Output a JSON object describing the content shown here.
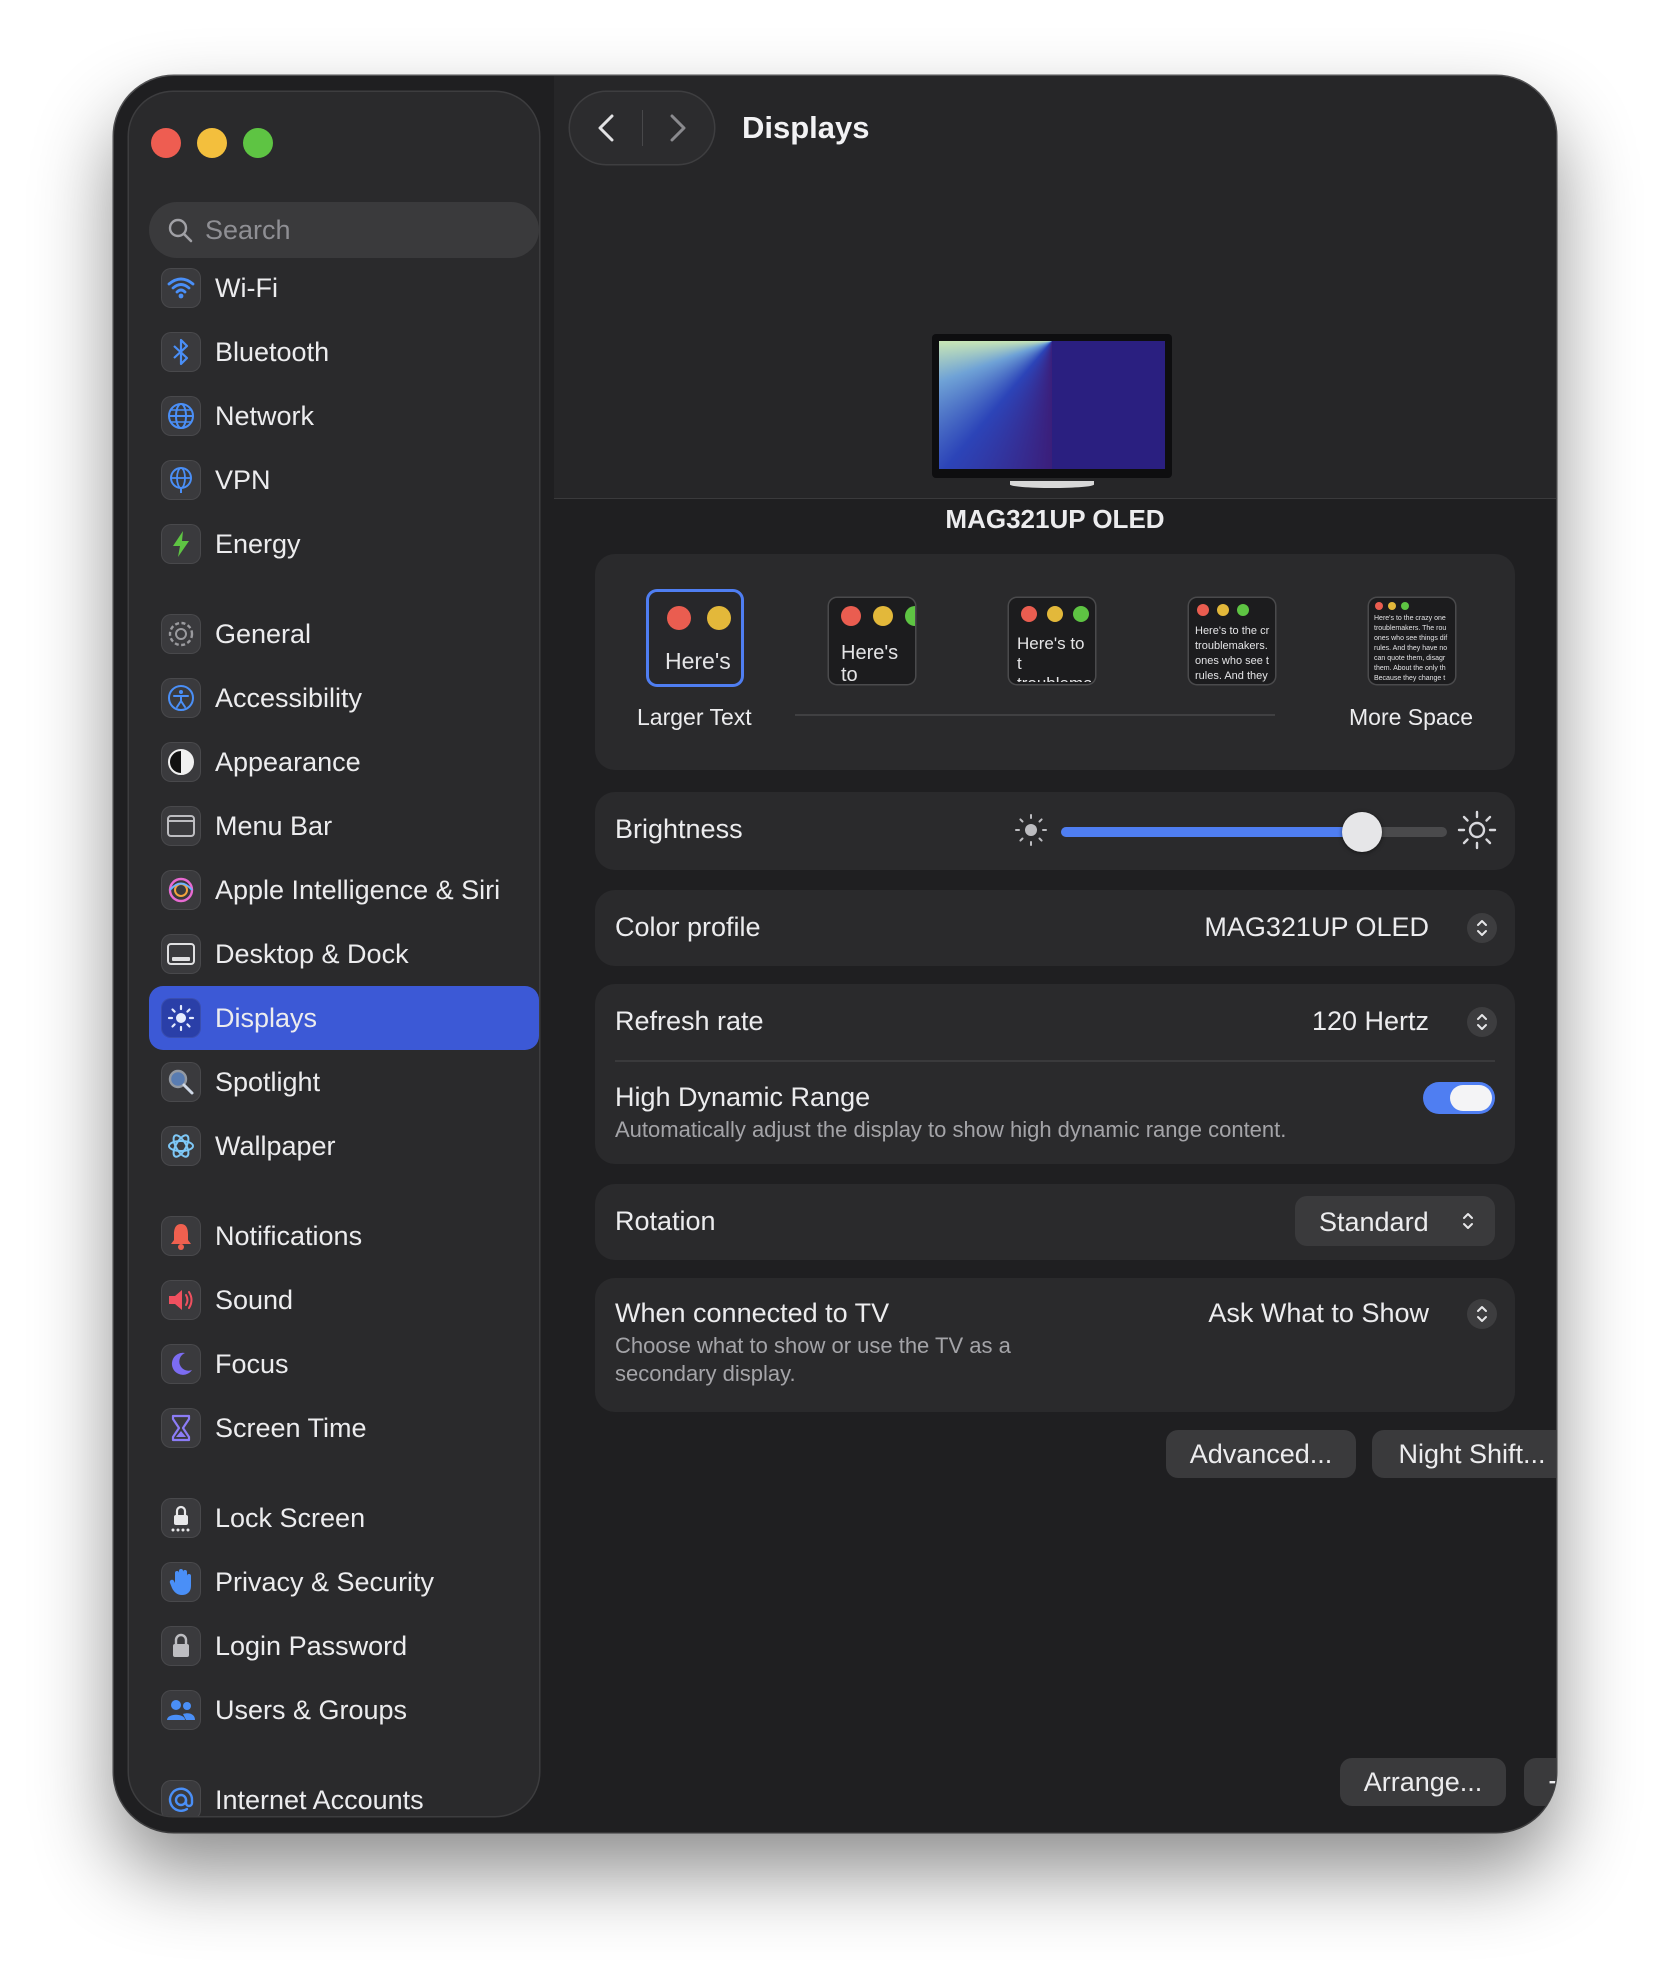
{
  "window": {
    "title": "Displays",
    "traffic_lights": [
      "close-button",
      "minimize-button",
      "zoom-button"
    ]
  },
  "sidebar": {
    "search_placeholder": "Search",
    "groups": [
      [
        {
          "label": "Wi-Fi",
          "icon": "wifi-icon"
        },
        {
          "label": "Bluetooth",
          "icon": "bluetooth-icon"
        },
        {
          "label": "Network",
          "icon": "globe-icon"
        },
        {
          "label": "VPN",
          "icon": "vpn-globe-icon"
        },
        {
          "label": "Energy",
          "icon": "lightning-icon"
        }
      ],
      [
        {
          "label": "General",
          "icon": "gear-icon"
        },
        {
          "label": "Accessibility",
          "icon": "accessibility-icon"
        },
        {
          "label": "Appearance",
          "icon": "appearance-icon"
        },
        {
          "label": "Menu Bar",
          "icon": "menu-bar-icon"
        },
        {
          "label": "Apple Intelligence & Siri",
          "icon": "siri-icon"
        },
        {
          "label": "Desktop & Dock",
          "icon": "dock-icon"
        },
        {
          "label": "Displays",
          "icon": "sun-icon",
          "active": true
        },
        {
          "label": "Spotlight",
          "icon": "spotlight-icon"
        },
        {
          "label": "Wallpaper",
          "icon": "wallpaper-icon"
        }
      ],
      [
        {
          "label": "Notifications",
          "icon": "bell-icon"
        },
        {
          "label": "Sound",
          "icon": "speaker-icon"
        },
        {
          "label": "Focus",
          "icon": "moon-icon"
        },
        {
          "label": "Screen Time",
          "icon": "hourglass-icon"
        }
      ],
      [
        {
          "label": "Lock Screen",
          "icon": "lock-screen-icon"
        },
        {
          "label": "Privacy & Security",
          "icon": "hand-icon"
        },
        {
          "label": "Login Password",
          "icon": "lock-icon"
        },
        {
          "label": "Users & Groups",
          "icon": "users-icon"
        }
      ],
      [
        {
          "label": "Internet Accounts",
          "icon": "at-icon"
        }
      ]
    ]
  },
  "display": {
    "name": "MAG321UP OLED"
  },
  "resolution": {
    "left_label": "Larger Text",
    "right_label": "More Space",
    "samples": [
      "Here's",
      "Here's to troublem",
      "Here's to t troublema ones who",
      "Here's to the cr troublemakers. ones who see t rules. And they",
      "Here's to the crazy one troublemakers. The rou ones who see things dif rules. And they have no can quote them, disagr them. About the only th Because they change t"
    ],
    "selected_index": 0
  },
  "brightness": {
    "label": "Brightness",
    "level_percent": 78
  },
  "color_profile": {
    "label": "Color profile",
    "value": "MAG321UP OLED"
  },
  "refresh_rate": {
    "label": "Refresh rate",
    "value": "120 Hertz"
  },
  "hdr": {
    "label": "High Dynamic Range",
    "description": "Automatically adjust the display to show high dynamic range content.",
    "enabled": true
  },
  "rotation": {
    "label": "Rotation",
    "value": "Standard"
  },
  "tv": {
    "label": "When connected to TV",
    "description_line1": "Choose what to show or use the TV as a",
    "description_line2": "secondary display.",
    "value": "Ask What to Show"
  },
  "buttons": {
    "advanced": "Advanced...",
    "night_shift": "Night Shift...",
    "help": "?",
    "arrange": "Arrange...",
    "add": "+",
    "more": "⌄"
  },
  "colors": {
    "accent": "#4f7ef2",
    "sidebar_selected": "#3c59d6",
    "window_bg": "#1f1f21",
    "card_bg": "#2a2a2c"
  }
}
